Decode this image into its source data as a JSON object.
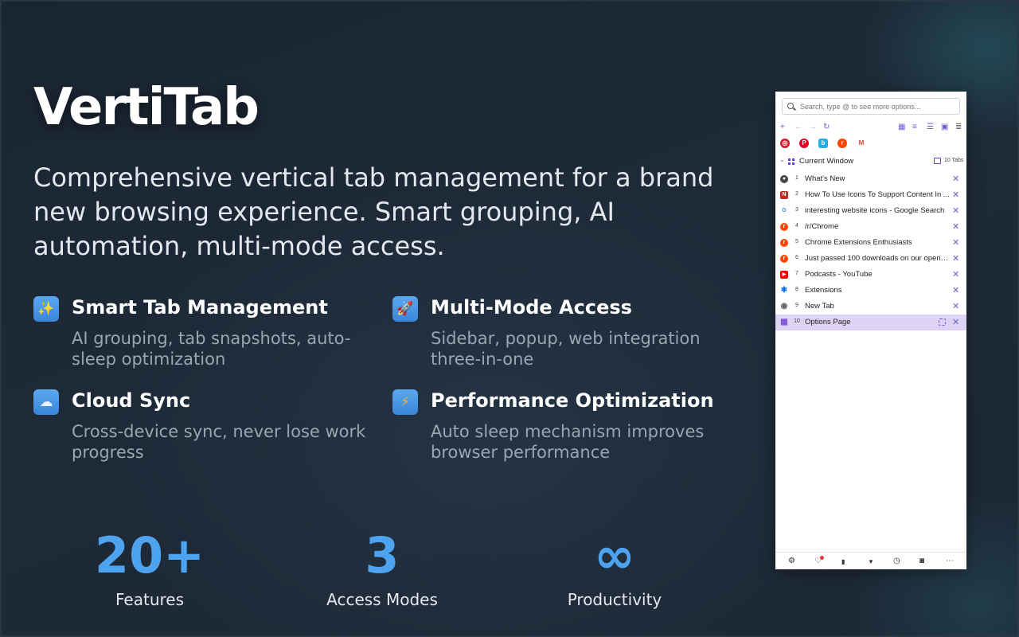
{
  "hero": {
    "title": "VertiTab",
    "subtitle": "Comprehensive vertical tab management for a brand new browsing experience. Smart grouping, AI automation, multi-mode access."
  },
  "features": [
    {
      "icon": "sparkles-icon",
      "glyph": "✨",
      "title": "Smart Tab Management",
      "desc": "AI grouping, tab snapshots, auto-sleep optimization"
    },
    {
      "icon": "rocket-icon",
      "glyph": "🚀",
      "title": "Multi-Mode Access",
      "desc": "Sidebar, popup, web integration three-in-one"
    },
    {
      "icon": "cloud-icon",
      "glyph": "☁",
      "title": "Cloud Sync",
      "desc": "Cross-device sync, never lose work progress"
    },
    {
      "icon": "lightning-icon",
      "glyph": "⚡",
      "title": "Performance Optimization",
      "desc": "Auto sleep mechanism improves browser performance"
    }
  ],
  "stats": [
    {
      "value": "20+",
      "label": "Features"
    },
    {
      "value": "3",
      "label": "Access Modes"
    },
    {
      "value": "∞",
      "label": "Productivity"
    }
  ],
  "panel": {
    "search_placeholder": "Search, type @ to see more options...",
    "toolbar": [
      {
        "icon": "plus-icon",
        "glyph": "+"
      },
      {
        "icon": "back-arrow-icon",
        "glyph": "←"
      },
      {
        "icon": "forward-arrow-icon",
        "glyph": "→"
      },
      {
        "icon": "reload-icon",
        "glyph": "↻"
      },
      {
        "icon": "calendar-icon",
        "glyph": "▦"
      },
      {
        "icon": "sort-icon",
        "glyph": "≡"
      },
      {
        "icon": "list-view-icon",
        "glyph": "☰"
      },
      {
        "icon": "sidebar-icon",
        "glyph": "▣"
      },
      {
        "icon": "filter-icon",
        "glyph": "≣"
      }
    ],
    "pinned": [
      {
        "icon": "target-icon",
        "glyph": "◎",
        "color": "#d61b2a"
      },
      {
        "icon": "pinterest-icon",
        "glyph": "P",
        "color": "#e60023"
      },
      {
        "icon": "bilibili-icon",
        "glyph": "b",
        "color": "#23ade5"
      },
      {
        "icon": "reddit-icon",
        "glyph": "r",
        "color": "#ff4500"
      },
      {
        "icon": "gmail-icon",
        "glyph": "M",
        "color": "#ea4335"
      }
    ],
    "window": {
      "label": "Current Window",
      "count": "10 Tabs"
    },
    "tabs": [
      {
        "index": "1",
        "title": "What's New",
        "favicon": "whats-new-favicon",
        "glyph": "●",
        "color": "#444444"
      },
      {
        "index": "2",
        "title": "How To Use Icons To Support Content In ...",
        "favicon": "article-favicon",
        "glyph": "N",
        "color": "#c62828"
      },
      {
        "index": "3",
        "title": "interesting website icons - Google Search",
        "favicon": "google-favicon",
        "glyph": "G",
        "color": "#4285f4"
      },
      {
        "index": "4",
        "title": "/r/Chrome",
        "favicon": "reddit-favicon",
        "glyph": "r",
        "color": "#ff4500"
      },
      {
        "index": "5",
        "title": "Chrome Extensions Enthusiasts",
        "favicon": "reddit-favicon",
        "glyph": "r",
        "color": "#ff4500"
      },
      {
        "index": "6",
        "title": "Just passed 100 downloads on our open s...",
        "favicon": "reddit-favicon",
        "glyph": "r",
        "color": "#ff4500"
      },
      {
        "index": "7",
        "title": "Podcasts - YouTube",
        "favicon": "youtube-favicon",
        "glyph": "▶",
        "color": "#ff0000"
      },
      {
        "index": "8",
        "title": "Extensions",
        "favicon": "puzzle-favicon",
        "glyph": "✱",
        "color": "#1a73e8"
      },
      {
        "index": "9",
        "title": "New Tab",
        "favicon": "chrome-favicon",
        "glyph": "◉",
        "color": "#5f6368"
      },
      {
        "index": "10",
        "title": "Options Page",
        "favicon": "vertitab-favicon",
        "glyph": "▦",
        "color": "#7b4fd6",
        "active": true
      }
    ],
    "bottom": [
      {
        "icon": "settings-icon",
        "glyph": "⚙"
      },
      {
        "icon": "heart-icon",
        "glyph": "♡"
      },
      {
        "icon": "trash-icon",
        "glyph": "▮"
      },
      {
        "icon": "bookmark-icon",
        "glyph": "▼"
      },
      {
        "icon": "history-icon",
        "glyph": "◷"
      },
      {
        "icon": "camera-icon",
        "glyph": "◙"
      },
      {
        "icon": "more-icon",
        "glyph": "⋯"
      }
    ]
  }
}
